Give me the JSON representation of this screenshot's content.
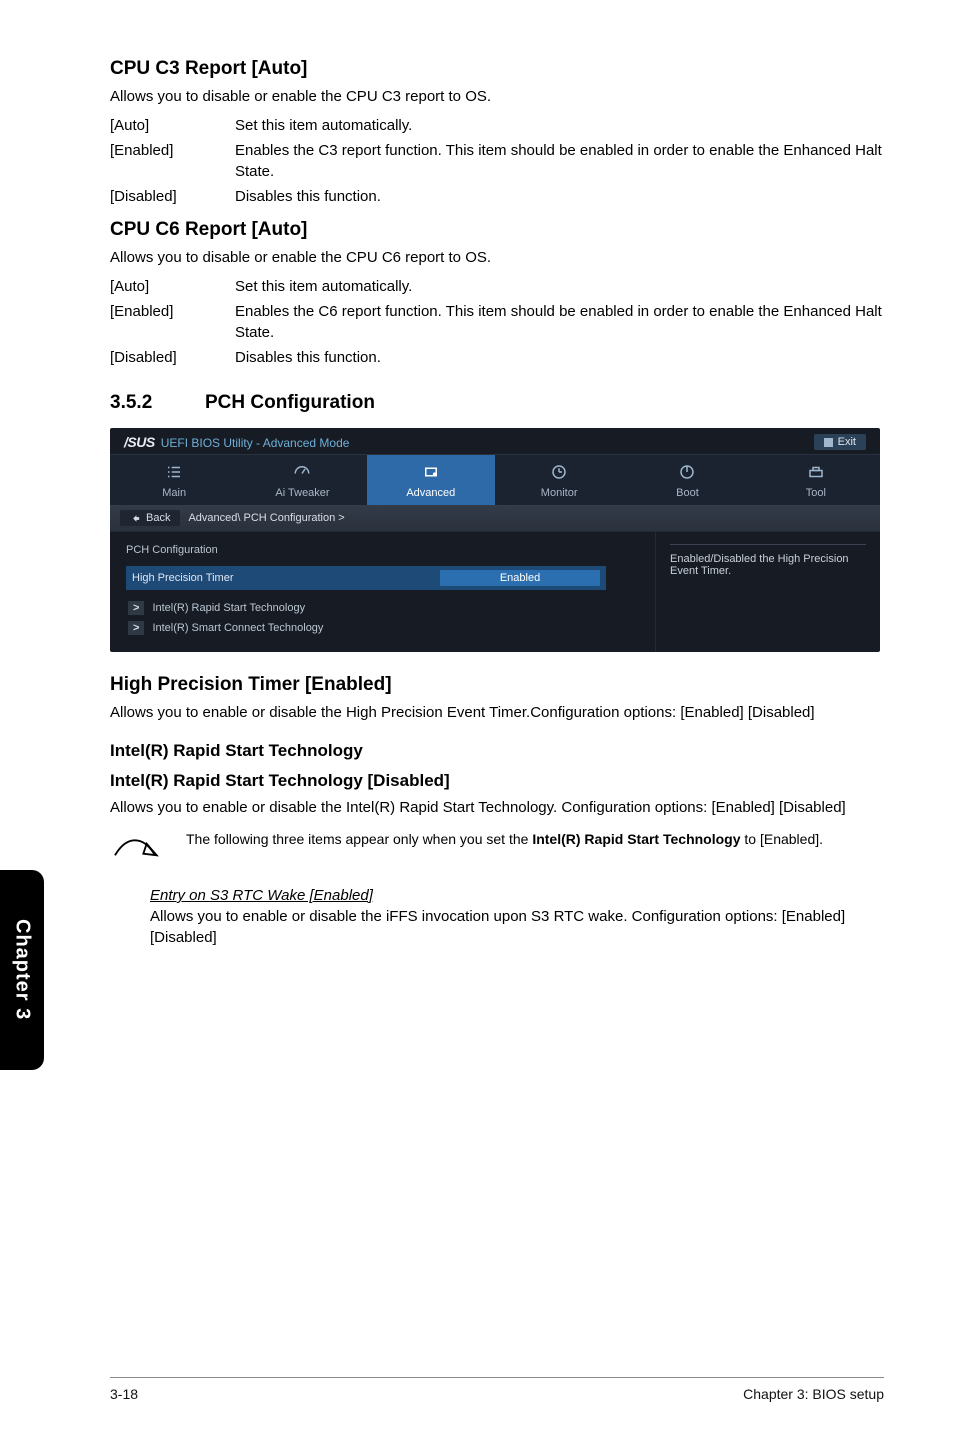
{
  "cpuC3": {
    "heading": "CPU C3 Report [Auto]",
    "desc": "Allows you to disable or enable the CPU C3 report to OS.",
    "opts": [
      {
        "k": "[Auto]",
        "v": "Set this item automatically."
      },
      {
        "k": "[Enabled]",
        "v": "Enables the C3 report function. This item should be enabled in order to enable the Enhanced Halt State."
      },
      {
        "k": "[Disabled]",
        "v": "Disables this function."
      }
    ]
  },
  "cpuC6": {
    "heading": "CPU C6 Report [Auto]",
    "desc": "Allows you to disable or enable the CPU C6 report to OS.",
    "opts": [
      {
        "k": "[Auto]",
        "v": "Set this item automatically."
      },
      {
        "k": "[Enabled]",
        "v": "Enables the C6 report function. This item should be enabled in order to enable the Enhanced Halt State."
      },
      {
        "k": "[Disabled]",
        "v": "Disables this function."
      }
    ]
  },
  "pch": {
    "num": "3.5.2",
    "title": "PCH Configuration"
  },
  "bios": {
    "brand": "/SUS",
    "subtitle": "UEFI BIOS Utility - Advanced Mode",
    "exit": "Exit",
    "tabs": [
      "Main",
      "Ai  Tweaker",
      "Advanced",
      "Monitor",
      "Boot",
      "Tool"
    ],
    "back": "Back",
    "crumb": "Advanced\\ PCH Configuration >",
    "cfgTitle": "PCH Configuration",
    "hpt": {
      "label": "High Precision Timer",
      "value": "Enabled"
    },
    "rows": [
      "Intel(R) Rapid Start Technology",
      "Intel(R) Smart Connect Technology"
    ],
    "help": "Enabled/Disabled the High Precision Event Timer."
  },
  "hpt": {
    "heading": "High Precision Timer [Enabled]",
    "desc": "Allows you to enable or disable the High Precision Event Timer.Configuration options: [Enabled] [Disabled]"
  },
  "irst": {
    "h1": "Intel(R) Rapid Start Technology",
    "h2": "Intel(R) Rapid Start Technology [Disabled]",
    "desc": "Allows you to enable or disable the Intel(R) Rapid Start Technology. Configuration options: [Enabled] [Disabled]"
  },
  "note": {
    "text_a": "The following three items appear only when you set the ",
    "bold": "Intel(R) Rapid Start Technology",
    "text_b": " to [Enabled]."
  },
  "entry": {
    "heading": "Entry on S3 RTC Wake [Enabled]",
    "desc": "Allows you to enable or disable the iFFS invocation upon S3 RTC wake. Configuration options: [Enabled] [Disabled]"
  },
  "sideTab": "Chapter 3",
  "footer": {
    "left": "3-18",
    "right": "Chapter 3: BIOS setup"
  }
}
